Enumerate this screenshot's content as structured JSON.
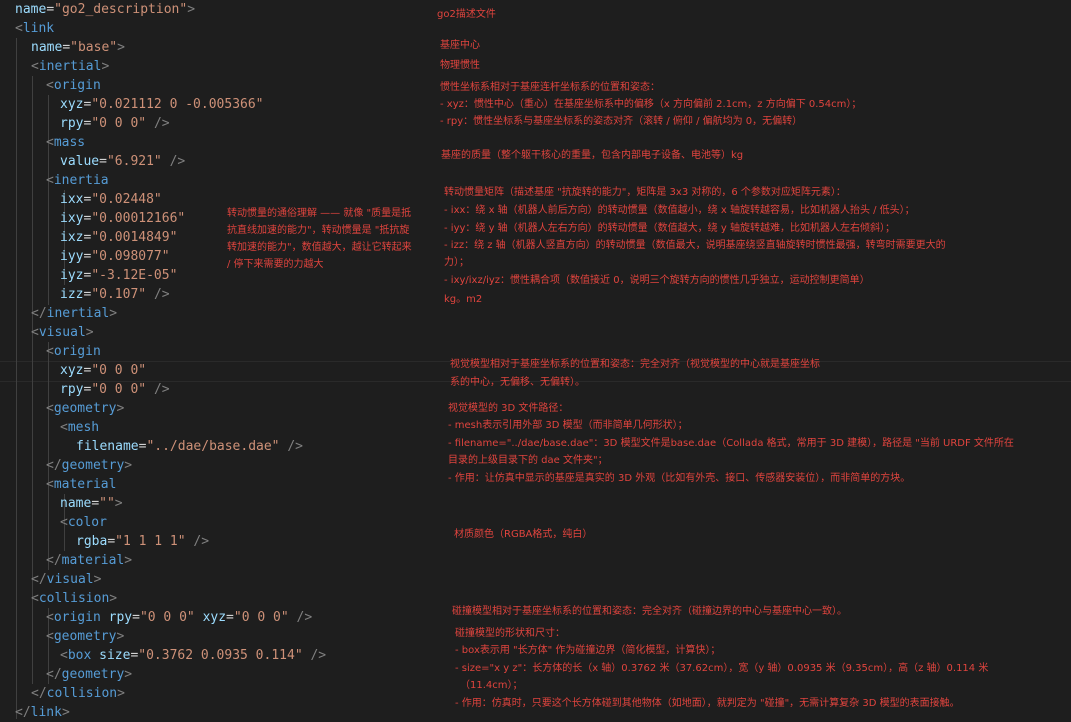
{
  "code_lines": [
    "name=\"go2_description\">",
    "<link",
    "name=\"base\">",
    "<inertial>",
    "<origin",
    "xyz=\"0.021112 0 -0.005366\"",
    "rpy=\"0 0 0\" />",
    "<mass",
    "value=\"6.921\" />",
    "<inertia",
    "ixx=\"0.02448\"",
    "ixy=\"0.00012166\"",
    "ixz=\"0.0014849\"",
    "iyy=\"0.098077\"",
    "iyz=\"-3.12E-05\"",
    "izz=\"0.107\" />",
    "</inertial>",
    "<visual>",
    "<origin",
    "xyz=\"0 0 0\"",
    "rpy=\"0 0 0\" />",
    "<geometry>",
    "<mesh",
    "filename=\"../dae/base.dae\" />",
    "</geometry>",
    "<material",
    "name=\"\">",
    "<color",
    "rgba=\"1 1 1 1\" />",
    "</material>",
    "</visual>",
    "<collision>",
    "<origin rpy=\"0 0 0\" xyz=\"0 0 0\" />",
    "<geometry>",
    "<box size=\"0.3762 0.0935 0.114\" />",
    "</geometry>",
    "</collision>",
    "</link>"
  ],
  "notes": {
    "robot_desc": "go2描述文件",
    "base_center": "基座中心",
    "inertia_title": "物理惯性",
    "origin_1": "惯性坐标系相对于基座连杆坐标系的位置和姿态：",
    "origin_2": "- xyz：惯性中心（重心）在基座坐标系中的偏移（x 方向偏前 2.1cm，z 方向偏下 0.54cm）；",
    "origin_3": "- rpy：惯性坐标系与基座坐标系的姿态对齐（滚转 / 俯仰 / 偏航均为 0，无偏转）",
    "mass": "基座的质量（整个躯干核心的重量，包含内部电子设备、电池等）kg",
    "inertia_1": "转动惯量矩阵（描述基座 \"抗旋转的能力\"，矩阵是 3x3 对称的，6 个参数对应矩阵元素）：",
    "inertia_2": "- ixx：绕 x 轴（机器人前后方向）的转动惯量（数值越小，绕 x 轴旋转越容易，比如机器人抬头 / 低头）；",
    "inertia_3": "- iyy：绕 y 轴（机器人左右方向）的转动惯量（数值越大，绕 y 轴旋转越难，比如机器人左右倾斜）；",
    "inertia_4": "- izz：绕 z 轴（机器人竖直方向）的转动惯量（数值最大，说明基座绕竖直轴旋转时惯性最强，转弯时需要更大的",
    "inertia_5": "力）；",
    "inertia_6": "- ixy/ixz/iyz：惯性耦合项（数值接近 0，说明三个旋转方向的惯性几乎独立，运动控制更简单）",
    "inertia_7": "kg。m2",
    "side_note": "转动惯量的通俗理解 —— 就像 \"质量是抵抗直线加速的能力\"，转动惯量是 \"抵抗旋转加速的能力\"，数值越大，越让它转起来 / 停下来需要的力越大",
    "visual_1": "视觉模型相对于基座坐标系的位置和姿态：完全对齐（视觉模型的中心就是基座坐标",
    "visual_2": "系的中心，无偏移、无偏转）。",
    "mesh_1": "视觉模型的 3D 文件路径：",
    "mesh_2": "- mesh表示引用外部 3D 模型（而非简单几何形状）；",
    "mesh_3": "- filename=\"../dae/base.dae\"：3D 模型文件是base.dae（Collada 格式，常用于 3D 建模），路径是 \"当前 URDF 文件所在",
    "mesh_4": "目录的上级目录下的 dae 文件夹\"；",
    "mesh_5": "- 作用：让仿真中显示的基座是真实的 3D 外观（比如有外壳、接口、传感器安装位），而非简单的方块。",
    "material": "材质颜色（RGBA格式，纯白）",
    "collision_1": "碰撞模型相对于基座坐标系的位置和姿态：完全对齐（碰撞边界的中心与基座中心一致）。",
    "collision_2": "碰撞模型的形状和尺寸：",
    "collision_3": "- box表示用 \"长方体\" 作为碰撞边界（简化模型，计算快）；",
    "collision_4": "- size=\"x y z\"：长方体的长（x 轴）0.3762 米（37.62cm），宽（y 轴）0.0935 米（9.35cm），高（z 轴）0.114 米",
    "collision_5": "（11.4cm）；",
    "collision_6": "- 作用：仿真时，只要这个长方体碰到其他物体（如地面），就判定为 \"碰撞\"，无需计算复杂 3D 模型的表面接触。"
  }
}
